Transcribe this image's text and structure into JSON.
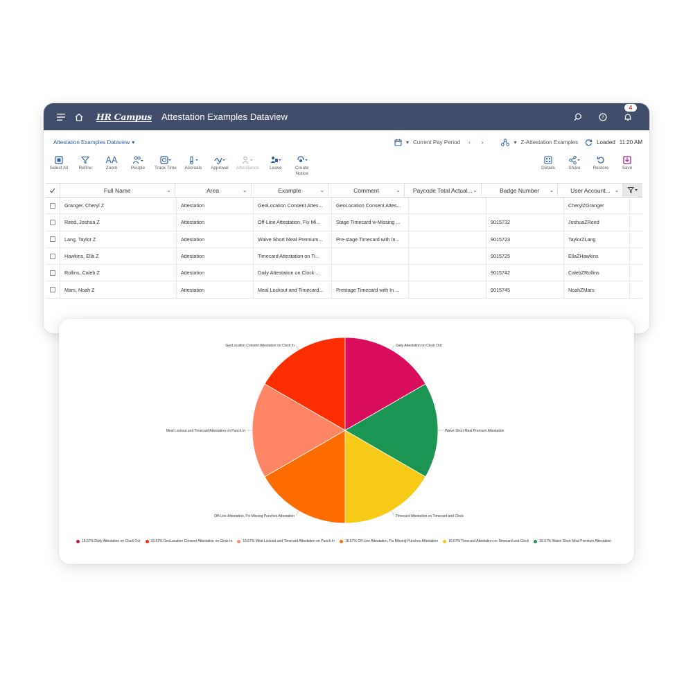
{
  "header": {
    "brand": "HR Campus",
    "title": "Attestation Examples Dataview",
    "notification_count": "4"
  },
  "subbar": {
    "view_name": "Attestation Examples Dataview",
    "period": "Current Pay Period",
    "hyperfind": "Z-Attestation Examples",
    "status": "Loaded",
    "time": "11:20 AM"
  },
  "toolbar": {
    "left": [
      {
        "label": "Select All",
        "icon": "select-all-icon"
      },
      {
        "label": "Refine",
        "icon": "filter-icon"
      },
      {
        "label": "Zoom",
        "icon": "zoom-icon"
      },
      {
        "label": "People",
        "icon": "people-icon"
      },
      {
        "label": "Track Time",
        "icon": "track-time-icon"
      },
      {
        "label": "Accruals",
        "icon": "accruals-icon"
      },
      {
        "label": "Approval",
        "icon": "approval-icon"
      },
      {
        "label": "Attendance",
        "icon": "attendance-icon",
        "disabled": true
      },
      {
        "label": "Leave",
        "icon": "leave-icon"
      },
      {
        "label": "Create\nNotice",
        "icon": "notice-icon"
      }
    ],
    "right": [
      {
        "label": "Details",
        "icon": "details-icon"
      },
      {
        "label": "Share",
        "icon": "share-icon"
      },
      {
        "label": "Restore",
        "icon": "restore-icon"
      },
      {
        "label": "Save",
        "icon": "save-icon"
      }
    ]
  },
  "grid": {
    "columns": [
      "Full Name",
      "Area",
      "Example",
      "Comment",
      "Paycode Total Actual...",
      "Badge Number",
      "User Account..."
    ],
    "rows": [
      [
        "Granger, Cheryl Z",
        "Attestation",
        "GeoLocation Consent Attes...",
        "GeoLocation Consent Attes...",
        "",
        "",
        "CherylZGranger"
      ],
      [
        "Reed, Joshua Z",
        "Attestation",
        "Off-Line Attestation, Fix Mi...",
        "Stage Timecard w-Missing ...",
        "",
        "9015732",
        "JoshuaZReed"
      ],
      [
        "Lang, Taylor Z",
        "Attestation",
        "Waive Short Meal Premium...",
        "Pre-stage Timecard with In...",
        "",
        "9015723",
        "TaylorZLang"
      ],
      [
        "Hawkins, Ella Z",
        "Attestation",
        "Timecard Attestation on Ti...",
        "",
        "",
        "9015725",
        "EllaZHawkins"
      ],
      [
        "Rollins, Caleb Z",
        "Attestation",
        "Daily Attestation on Clock ...",
        "",
        "",
        "9015742",
        "CalebZRollins"
      ],
      [
        "Mars, Noah Z",
        "Attestation",
        "Meal Lockout and Timecard...",
        "Prestage Timecard with In ...",
        "",
        "9015745",
        "NoahZMars"
      ]
    ]
  },
  "chart_data": {
    "type": "pie",
    "title": "",
    "slices": [
      {
        "label": "GeoLocation Consent Attestation on Clock In",
        "value": 16.67,
        "color": "#ff2e00"
      },
      {
        "label": "Daily Attestation on Clock Out",
        "value": 16.67,
        "color": "#d90d5c"
      },
      {
        "label": "Waive Short Meal Premium Attestation",
        "value": 16.67,
        "color": "#1a9652"
      },
      {
        "label": "Timecard Attestation on Timecard and Clock",
        "value": 16.67,
        "color": "#f7ca18"
      },
      {
        "label": "Off-Line Attestation, Fix Missing Punches Attestation",
        "value": 16.67,
        "color": "#ff6c00"
      },
      {
        "label": "Meal Lockout and Timecard Attestation on Punch In",
        "value": 16.67,
        "color": "#ff8566"
      }
    ],
    "legend": [
      {
        "text": "16.67% Daily Attestation on Clock Out",
        "color": "#d90d5c"
      },
      {
        "text": "16.67% GeoLocation Consent Attestation on Clock In",
        "color": "#ff2e00"
      },
      {
        "text": "16.67% Meal Lockout and Timecard Attestation on Punch In",
        "color": "#ff8566"
      },
      {
        "text": "16.67% Off-Line Attestation, Fix Missing Punches Attestation",
        "color": "#ff6c00"
      },
      {
        "text": "16.67% Timecard Attestation on Timecard and Clock",
        "color": "#f7ca18"
      },
      {
        "text": "16.67% Waive Short Meal Premium Attestation",
        "color": "#1a9652"
      }
    ],
    "legend_position": "bottom"
  }
}
